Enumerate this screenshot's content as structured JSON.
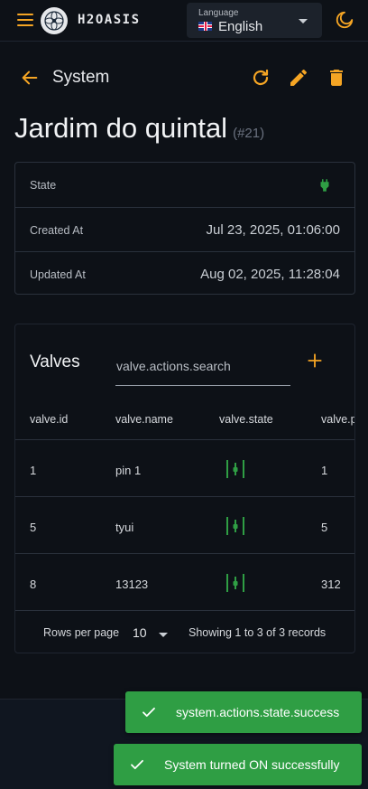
{
  "header": {
    "brand": "H2OASIS",
    "language": {
      "label": "Language",
      "value": "English",
      "flag": "uk-flag"
    },
    "accent_color": "#f5a524"
  },
  "toolbar": {
    "title": "System",
    "actions": [
      "refresh-icon",
      "edit-icon",
      "delete-icon"
    ]
  },
  "system": {
    "name": "Jardim do quintal",
    "id_label": "(#21)"
  },
  "details": {
    "state_label": "State",
    "state_icon": "plug-icon",
    "state_color": "#2f9e44",
    "created_label": "Created At",
    "created_value": "Jul 23, 2025, 01:06:00",
    "updated_label": "Updated At",
    "updated_value": "Aug 02, 2025, 11:28:04"
  },
  "valves": {
    "title": "Valves",
    "search_placeholder": "valve.actions.search",
    "columns": [
      "valve.id",
      "valve.name",
      "valve.state",
      "valve.p"
    ],
    "rows": [
      {
        "id": "1",
        "name": "pin 1",
        "state_icon": "valve-toggle-icon",
        "pin": "1"
      },
      {
        "id": "5",
        "name": "tyui",
        "state_icon": "valve-toggle-icon",
        "pin": "5"
      },
      {
        "id": "8",
        "name": "13123",
        "state_icon": "valve-toggle-icon",
        "pin": "312"
      }
    ],
    "pagination": {
      "rows_label": "Rows per page",
      "rows_value": "10",
      "info": "Showing 1 to 3 of 3 records"
    }
  },
  "toasts": [
    {
      "text": "system.actions.state.success"
    },
    {
      "text": "System turned ON successfully"
    }
  ],
  "toast_color": "#2f9e44"
}
